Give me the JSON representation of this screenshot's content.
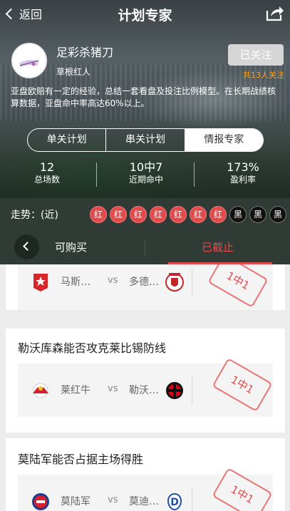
{
  "nav": {
    "back_label": "返回",
    "title": "计划专家"
  },
  "profile": {
    "name": "足彩杀猪刀",
    "tag": "草根红人",
    "follow_label": "已关注",
    "follow_count": "共13人关注"
  },
  "description": "亚盘欧赔有一定的经验，总结一套看盘及投注比例模型。在长期战绩核算数据，亚盘命中率高达60%以上。",
  "tabs": [
    {
      "label": "单关计划",
      "active": false
    },
    {
      "label": "串关计划",
      "active": false
    },
    {
      "label": "情报专家",
      "active": true
    }
  ],
  "stats": [
    {
      "value": "12",
      "label": "总场数"
    },
    {
      "value": "10中7",
      "label": "近期命中"
    },
    {
      "value": "173%",
      "label": "盈利率"
    }
  ],
  "trend": {
    "label": "走势：(近)",
    "results": [
      "红",
      "红",
      "红",
      "红",
      "红",
      "红",
      "红",
      "黑",
      "黑",
      "黑"
    ]
  },
  "subtabs": {
    "buy_label": "可购买",
    "closed_label": "已截止"
  },
  "cards": [
    {
      "title": "",
      "home": "马斯…",
      "vs": "vs",
      "away": "多德…",
      "result": "1中1"
    },
    {
      "title": "勒沃库森能否攻克莱比锡防线",
      "home": "莱红牛",
      "vs": "vs",
      "away": "勒沃…",
      "result": "1中1"
    },
    {
      "title": "莫陆军能否占据主场得胜",
      "home": "莫陆军",
      "vs": "vs",
      "away": "莫迪…",
      "result": "1中1"
    }
  ],
  "colors": {
    "accent_red": "#e24b4b",
    "follow_orange": "#f5a623",
    "dark_green": "#2f3b34"
  }
}
